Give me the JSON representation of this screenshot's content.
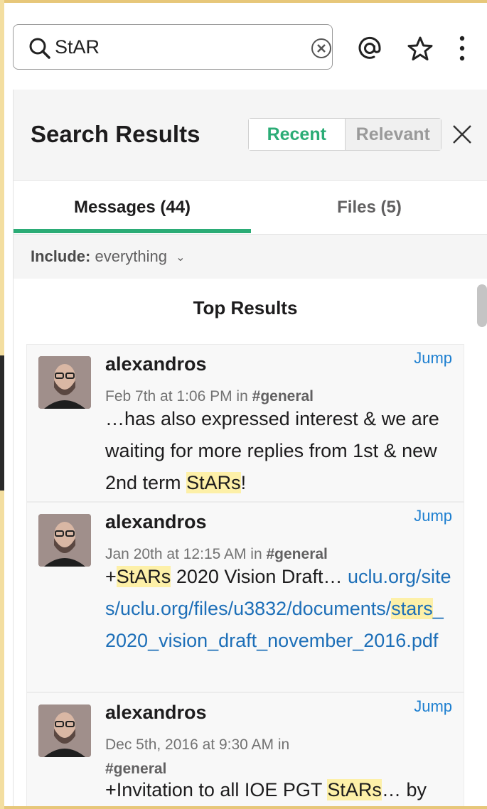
{
  "search": {
    "query": "StAR",
    "placeholder": ""
  },
  "panel": {
    "title": "Search Results",
    "sort_options": [
      "Recent",
      "Relevant"
    ],
    "active_sort": "Recent"
  },
  "tabs": [
    {
      "label": "Messages (44)",
      "active": true
    },
    {
      "label": "Files (5)",
      "active": false
    }
  ],
  "filter": {
    "label": "Include:",
    "value": "everything"
  },
  "results": {
    "section_title": "Top Results",
    "jump_label": "Jump",
    "items": [
      {
        "author": "alexandros",
        "timestamp": "Feb 7th at 1:06 PM in",
        "channel": "#general",
        "text_before": "…has also expressed interest & we are waiting for more replies from 1st & new 2nd term ",
        "highlight": "StARs",
        "text_after": "!"
      },
      {
        "author": "alexandros",
        "timestamp": "Jan 20th at 12:15 AM in",
        "channel": "#general",
        "text_prefix": "+",
        "highlight": "StARs",
        "text_after": " 2020 Vision Draft… ",
        "link_before": "uclu.org/sites/uclu.org/files/u3832/documents/",
        "link_highlight": "stars",
        "link_after": "_2020_vision_draft_november_2016.pdf"
      },
      {
        "author": "alexandros",
        "timestamp": "Dec 5th, 2016 at 9:30 AM in",
        "channel": "#general",
        "text_before": "+Invitation to all IOE PGT ",
        "highlight": "StARs",
        "text_after": "… by"
      }
    ]
  },
  "colors": {
    "accent_green": "#2bac76",
    "link_blue": "#1d7fd0",
    "highlight": "#fdf0a8"
  }
}
